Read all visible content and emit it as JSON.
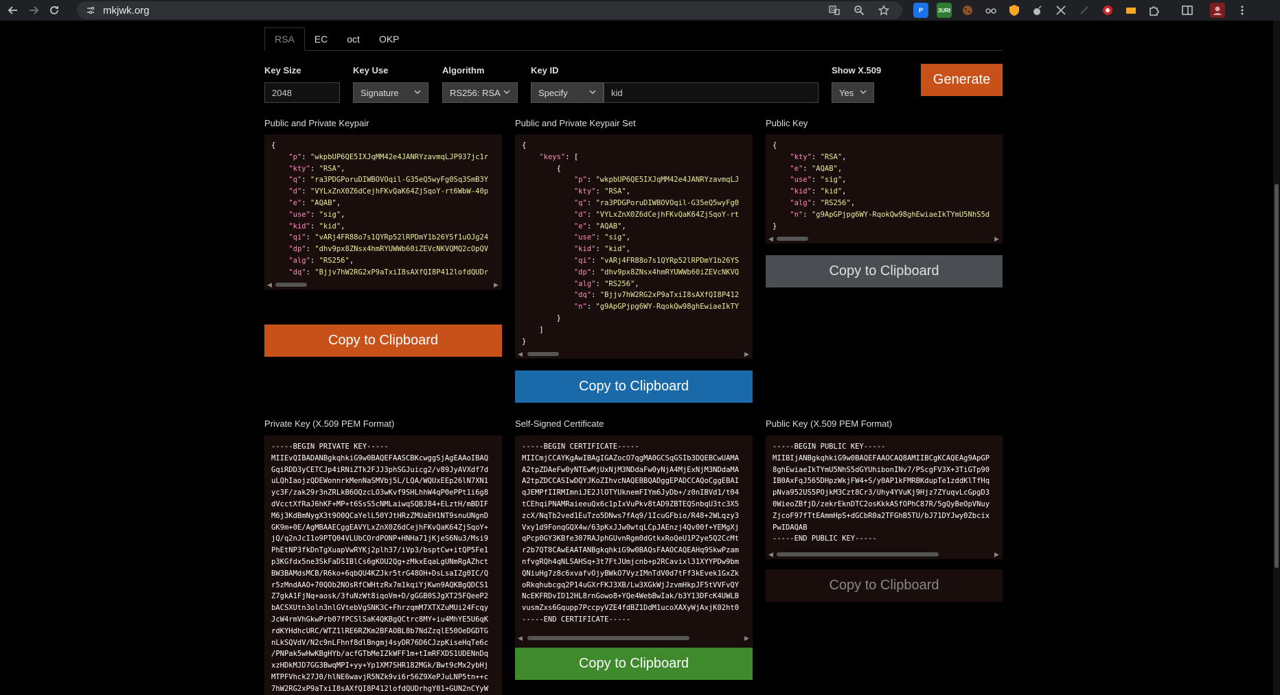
{
  "browser": {
    "url": "mkjwk.org",
    "extensions": [
      {
        "name": "p-extension",
        "label": "P",
        "color": "#1a73e8"
      },
      {
        "name": "buri-extension",
        "label": "3URI",
        "color": "#2e7d32"
      },
      {
        "name": "cookie-extension",
        "label": "",
        "color": "#8d4e2a"
      },
      {
        "name": "glasses-extension",
        "label": "",
        "color": "#555"
      },
      {
        "name": "brave-extension",
        "label": "",
        "color": "#fb8c00"
      },
      {
        "name": "bomb-extension",
        "label": "",
        "color": "#333"
      },
      {
        "name": "x-extension",
        "label": "",
        "color": "#444"
      },
      {
        "name": "dimmed-extension",
        "label": "",
        "color": "#2a2a2a"
      },
      {
        "name": "vpn-extension",
        "label": "",
        "color": "#c62828"
      },
      {
        "name": "folder-extension",
        "label": "",
        "color": "#f9a825"
      }
    ]
  },
  "tabs": [
    {
      "label": "RSA",
      "active": true
    },
    {
      "label": "EC",
      "active": false
    },
    {
      "label": "oct",
      "active": false
    },
    {
      "label": "OKP",
      "active": false
    }
  ],
  "form": {
    "key_size": {
      "label": "Key Size",
      "value": "2048"
    },
    "key_use": {
      "label": "Key Use",
      "value": "Signature"
    },
    "algorithm": {
      "label": "Algorithm",
      "value": "RS256: RSA"
    },
    "key_id": {
      "label": "Key ID",
      "mode": "Specify",
      "value": "kid"
    },
    "show_x509": {
      "label": "Show X.509",
      "value": "Yes"
    },
    "generate_label": "Generate"
  },
  "panels": {
    "keypair": {
      "label": "Public and Private Keypair",
      "lines": [
        "{",
        "    \"p\": \"wkpbUP6QE5IXJqMM42e4JANRYzavmqLJP937jc1r",
        "    \"kty\": \"RSA\",",
        "    \"q\": \"ra3PDGPoruDIWBOVOqil-G35eQ5wyFg0Sq3SmB3Y",
        "    \"d\": \"VYLxZnX0Z6dCejhFKvQaK64ZjSqoY-rt6WbW-40p",
        "    \"e\": \"AQAB\",",
        "    \"use\": \"sig\",",
        "    \"kid\": \"kid\",",
        "    \"qi\": \"vARj4FR88o7s1QYRp52lRPDmY1b26YSf1uOJg24",
        "    \"dp\": \"dhv9px8ZNsx4hmRYUWWb60iZEVcNKVQMQ2cOpQV",
        "    \"alg\": \"RS256\",",
        "    \"dq\": \"Bjjv7hW2RG2xP9aTxiI8sAXfQI8P412lofdQUDr",
        "    \"n\": \"g9ApGPjpg6WY-RqokQw98ghEwiaeIkTYmU5NhS5d",
        "}"
      ],
      "copy_label": "Copy to Clipboard"
    },
    "keypair_set": {
      "label": "Public and Private Keypair Set",
      "lines": [
        "{",
        "    \"keys\": [",
        "        {",
        "            \"p\": \"wkpbUP6QE5IXJqMM42e4JANRYzavmqLJ",
        "            \"kty\": \"RSA\",",
        "            \"q\": \"ra3PDGPoruDIWBOVOqil-G35eQ5wyFg0",
        "            \"d\": \"VYLxZnX0Z6dCejhFKvQaK64ZjSqoY-rt",
        "            \"e\": \"AQAB\",",
        "            \"use\": \"sig\",",
        "            \"kid\": \"kid\",",
        "            \"qi\": \"vARj4FR88o7s1QYRp52lRPDmY1b26YS",
        "            \"dp\": \"dhv9px8ZNsx4hmRYUWWb60iZEVcNKVQ",
        "            \"alg\": \"RS256\",",
        "            \"dq\": \"Bjjv7hW2RG2xP9aTxiI8sAXfQI8P412",
        "            \"n\": \"g9ApGPjpg6WY-RqokQw98ghEwiaeIkTY",
        "        }",
        "    ]",
        "}"
      ],
      "copy_label": "Copy to Clipboard"
    },
    "public_key": {
      "label": "Public Key",
      "lines": [
        "{",
        "    \"kty\": \"RSA\",",
        "    \"e\": \"AQAB\",",
        "    \"use\": \"sig\",",
        "    \"kid\": \"kid\",",
        "    \"alg\": \"RS256\",",
        "    \"n\": \"g9ApGPjpg6WY-RqokQw98ghEwiaeIkTYmU5NhS5d",
        "}"
      ],
      "copy_label": "Copy to Clipboard"
    },
    "private_pem": {
      "label": "Private Key (X.509 PEM Format)",
      "lines": [
        "-----BEGIN PRIVATE KEY-----",
        "MIIEvQIBADANBgkqhkiG9w0BAQEFAASCBKcwggSjAgEAAoIBAQ",
        "GqiRDD3yCETCJp4iRNiZTk2FJJ3phSGJuicg2/v89JyAVXdf7d",
        "uLQhIaojzQDEWonnrkMenNaSMVbj5L/LQA/WQUxEEp26lN7XN1",
        "yc3F/zak29r3nZRLkB6OQzcLO3wKvf9SHLhhW4qP0ePPt1i6g8",
        "dVcctXfRaJ6hKF+MP+t6SsS5cNMLaiwqSQBJ84+ELztH/mBDIF",
        "M6j3KdBmNygX3t9O0QCaYelL50YJtHRzZMUaEH1NT9snuUNgnD",
        "GK9m+0E/AgMBAAECggEAVYLxZnX0Z6dCejhFKvQaK64ZjSqoY+",
        "jQ/q2nJcI1o9PTQ04VLUbCOrdPONP+HNHa71jKjeS6Nu3/Msi9",
        "PhEtNP3fkDnTgXuapVwRYKj2plh37/iVp3/bsptCw+itQP5Fe1",
        "p3KGfdx5ne3SkFaDSIBlCs6gKOU2Qg+zMkxEqaLgUNmRgAZhct",
        "BW3BAMdsMCB/R6ko+6qbQU4KZJkr5trG48OH+DsLsaIZg0IC/Q",
        "r5zMndAAO+70QOb2NOsRfCWHtzRx7m1kqiYjKwn9AQKBgQDCS1",
        "Z7gkA1FjNq+aosk/3fuNzWt8iqoVm+D/gGGB0SJgXT25FQeeP2",
        "bACSXUtn3oln3nlGVtebVgSNK3C+FhrzqmM7XTXZuMUi24Fcqy",
        "JcW4rmVhGkwPrb07fPCSlSaK4QKBgQCtrc8MY+iu4MhYE5U6qK",
        "rdKYHdhcURC/WTZ1lRE6RZKm2BFAOBL8b7NdZzqlE50OeDGDTG",
        "nLkSQVdV/N2c9nLFhnf8dlBngmj4syDR76D6CJzpKiseHqTe6c",
        "/PNPak5wHwKBgHYb/acfGTbMeIZkWFF1m+tImRFXDS1UDENnDq",
        "xzHDkMJD7GG3BwqMPI+yy+Yp1XM7SHR182MGk/Bwt9cMx2ybHj",
        "MTPFVhck27J0/hlNE6wavjR5NZk9vi6r56Z9XePJuLNP5tn++c",
        "7hW2RG2xP9aTxiI8sAXfQI8P412lofdQUDrhgY01+GUN2nCYyW"
      ]
    },
    "certificate": {
      "label": "Self-Signed Certificate",
      "lines": [
        "-----BEGIN CERTIFICATE-----",
        "MIICmjCCAYKgAwIBAgIGAZocO7qgMA0GCSqGSIb3DQEBCwUAMA",
        "A2tpZDAeFw0yNTEwMjUxNjM3NDdaFw0yNjA4MjExNjM3NDdaMA",
        "A2tpZDCCASIwDQYJKoZIhvcNAQEBBQADggEPADCCAQoCggEBAI",
        "qJEMPfIIRMImniJE2JlOTYUknemFIYm6JyDb+/z0nIBVd1/t04",
        "tCEhqiPNAMRaieeuQx6c1pIxVuPkv8tAD9ZBTEQSnbqU3tc3X5",
        "zcX/NqTb2ved1EuTzo5DNws7fAq9/1IcuGFbio/R48+2WLqzy3",
        "Vxy1d9FonqGQX4w/63pKxJJw0wtqLCpJAEnzj4Qv00f+YEMgXj",
        "qPcp0GY3KBfe307RAJphGUvnRgm0dGtkxRoQeU1P2ye5Q2CcMt",
        "r2b7QT8CAwEAATANBgkqhkiG9w0BAQsFAAOCAQEAHq9SkwPzam",
        "nfvgRQh4qNLSAHSq+3t7FtJUmjcnb+p2RCavixl31XYYPDw9bm",
        "QNiuHg7z8c6xvafvOjyBWkO7VyzIMnTdV0d7tFf3kEvek1GxZk",
        "oRkqhubcgq2P14uGXrFKJ3XB/Lw3XGkWjJzvmHkpJF5tVVFvQY",
        "NcEKFRDvID12HL8rnGowo8+YQe4WebBwIak/b3Y13DFcK4UWLB",
        "vusmZxs6Gqupp7PccpyVZE4fdBZ1DdM1ucoXAXyWjAxjK02ht0",
        "-----END CERTIFICATE-----"
      ],
      "copy_label": "Copy to Clipboard"
    },
    "public_pem": {
      "label": "Public Key (X.509 PEM Format)",
      "lines": [
        "-----BEGIN PUBLIC KEY-----",
        "MIIBIjANBgkqhkiG9w0BAQEFAAOCAQ8AMIIBCgKCAQEAg9ApGP",
        "8ghEwiaeIkTYmU5NhS5dGYUhibonINv7/PScgFV3X+3TiGTp90",
        "IB0AxFqJ565DHpzWkjFW4+S/y0AP1kFMRBKdupTe1zddKlTfHq",
        "pNva952US5POjkM3Czt8Cr3/Uhy4YVuKj9Hjz7ZYuqvLcGpgD3",
        "0WieoZBfjD/zekrEknDTC2osKkkASfOPhC87R/5gQyBeOpVNuy",
        "ZjcoF97fTtEAmmHpS+dGCbR0a2TFGhB5TU/bJ71DYJwy0Zbcix",
        "PwIDAQAB",
        "-----END PUBLIC KEY-----"
      ],
      "copy_label": "Copy to Clipboard"
    }
  }
}
